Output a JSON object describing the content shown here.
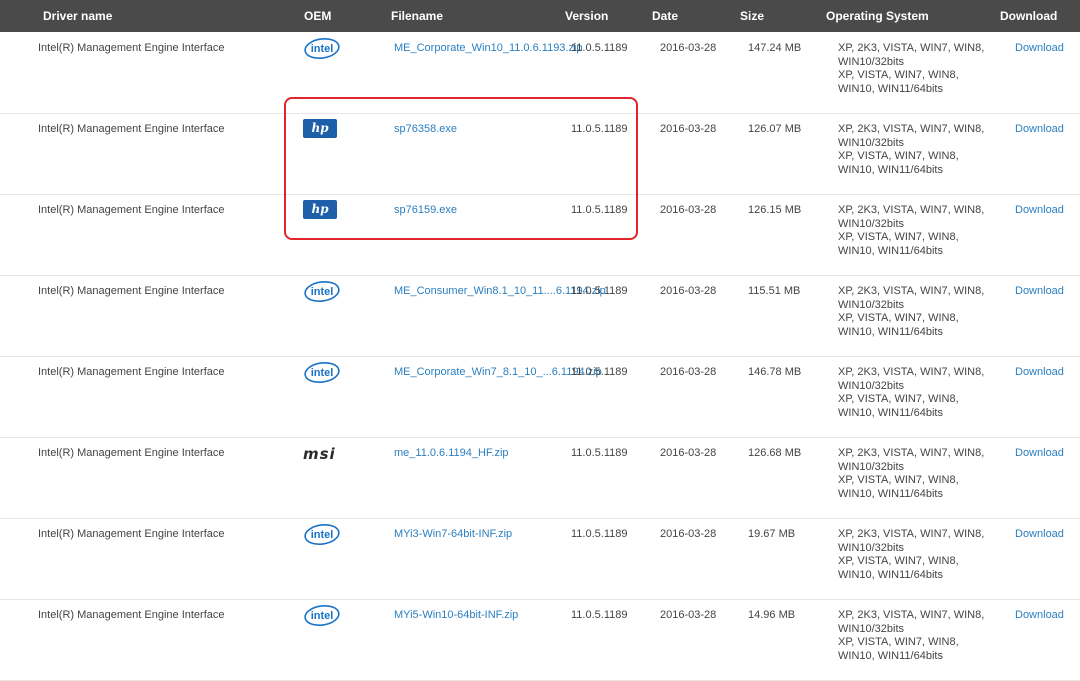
{
  "header": {
    "driver_name": "Driver name",
    "oem": "OEM",
    "filename": "Filename",
    "version": "Version",
    "date": "Date",
    "size": "Size",
    "os": "Operating System",
    "download": "Download"
  },
  "colors": {
    "link": "#2a7fc1",
    "header_bg": "#4a4a4a",
    "highlight": "#e0262b"
  },
  "rows": [
    {
      "name": "Intel(R) Management Engine Interface",
      "oem": "intel",
      "file": "ME_Corporate_Win10_11.0.6.1193.zip",
      "version": "11.0.5.1189",
      "date": "2016-03-28",
      "size": "147.24 MB",
      "os": [
        "XP, 2K3, VISTA, WIN7, WIN8,",
        "WIN10/32bits",
        "XP, VISTA, WIN7, WIN8,",
        "WIN10, WIN11/64bits"
      ],
      "download": "Download"
    },
    {
      "name": "Intel(R) Management Engine Interface",
      "oem": "hp",
      "file": "sp76358.exe",
      "version": "11.0.5.1189",
      "date": "2016-03-28",
      "size": "126.07 MB",
      "os": [
        "XP, 2K3, VISTA, WIN7, WIN8,",
        "WIN10/32bits",
        "XP, VISTA, WIN7, WIN8,",
        "WIN10, WIN11/64bits"
      ],
      "download": "Download"
    },
    {
      "name": "Intel(R) Management Engine Interface",
      "oem": "hp",
      "file": "sp76159.exe",
      "version": "11.0.5.1189",
      "date": "2016-03-28",
      "size": "126.15 MB",
      "os": [
        "XP, 2K3, VISTA, WIN7, WIN8,",
        "WIN10/32bits",
        "XP, VISTA, WIN7, WIN8,",
        "WIN10, WIN11/64bits"
      ],
      "download": "Download"
    },
    {
      "name": "Intel(R) Management Engine Interface",
      "oem": "intel",
      "file": "ME_Consumer_Win8.1_10_11....6.1194.zip",
      "version": "11.0.5.1189",
      "date": "2016-03-28",
      "size": "115.51 MB",
      "os": [
        "XP, 2K3, VISTA, WIN7, WIN8,",
        "WIN10/32bits",
        "XP, VISTA, WIN7, WIN8,",
        "WIN10, WIN11/64bits"
      ],
      "download": "Download"
    },
    {
      "name": "Intel(R) Management Engine Interface",
      "oem": "intel",
      "file": "ME_Corporate_Win7_8.1_10_...6.1194.zip",
      "version": "11.0.5.1189",
      "date": "2016-03-28",
      "size": "146.78 MB",
      "os": [
        "XP, 2K3, VISTA, WIN7, WIN8,",
        "WIN10/32bits",
        "XP, VISTA, WIN7, WIN8,",
        "WIN10, WIN11/64bits"
      ],
      "download": "Download"
    },
    {
      "name": "Intel(R) Management Engine Interface",
      "oem": "msi",
      "file": "me_11.0.6.1194_HF.zip",
      "version": "11.0.5.1189",
      "date": "2016-03-28",
      "size": "126.68 MB",
      "os": [
        "XP, 2K3, VISTA, WIN7, WIN8,",
        "WIN10/32bits",
        "XP, VISTA, WIN7, WIN8,",
        "WIN10, WIN11/64bits"
      ],
      "download": "Download"
    },
    {
      "name": "Intel(R) Management Engine Interface",
      "oem": "intel",
      "file": "MYi3-Win7-64bit-INF.zip",
      "version": "11.0.5.1189",
      "date": "2016-03-28",
      "size": "19.67 MB",
      "os": [
        "XP, 2K3, VISTA, WIN7, WIN8,",
        "WIN10/32bits",
        "XP, VISTA, WIN7, WIN8,",
        "WIN10, WIN11/64bits"
      ],
      "download": "Download"
    },
    {
      "name": "Intel(R) Management Engine Interface",
      "oem": "intel",
      "file": "MYi5-Win10-64bit-INF.zip",
      "version": "11.0.5.1189",
      "date": "2016-03-28",
      "size": "14.96 MB",
      "os": [
        "XP, 2K3, VISTA, WIN7, WIN8,",
        "WIN10/32bits",
        "XP, VISTA, WIN7, WIN8,",
        "WIN10, WIN11/64bits"
      ],
      "download": "Download"
    }
  ]
}
